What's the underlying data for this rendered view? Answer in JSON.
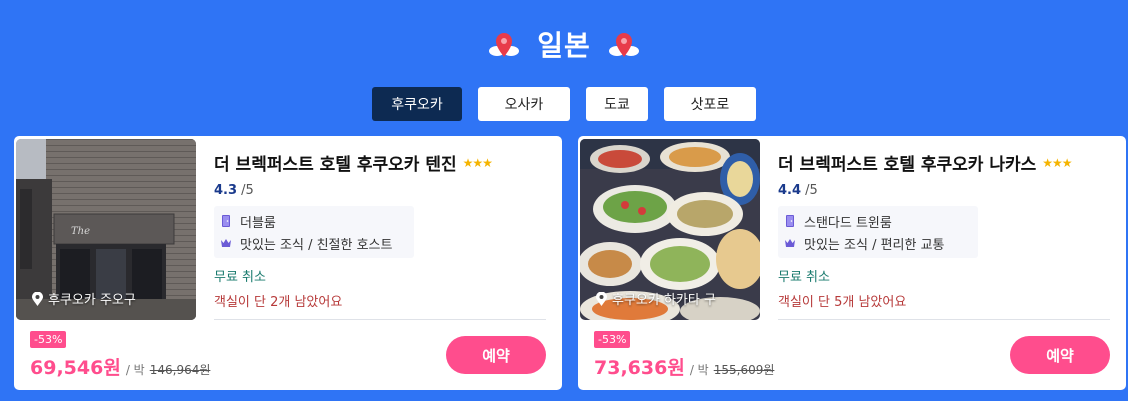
{
  "header": {
    "title": "일본",
    "colors": {
      "background": "#2f74f5",
      "pin": "#e83b4a",
      "cloud": "#ffffff"
    }
  },
  "tabs": [
    {
      "label": "후쿠오카",
      "active": true
    },
    {
      "label": "오사카",
      "active": false
    },
    {
      "label": "도쿄",
      "active": false
    },
    {
      "label": "삿포로",
      "active": false
    }
  ],
  "hotels": [
    {
      "name": "더 브렉퍼스트 호텔 후쿠오카 텐진",
      "stars": "★★★",
      "rating": "4.3",
      "rating_max": "/5",
      "room_type": "더블룸",
      "highlights": "맛있는 조식 / 친절한 호스트",
      "cancellation": "무료 취소",
      "availability": "객실이 단 2개 남았어요",
      "location": "후쿠오카 주오구",
      "discount": "-53%",
      "price": "69,546원",
      "per_night": "/ 박",
      "original_price": "146,964원",
      "book_label": "예약",
      "image": "hotel-building-photo"
    },
    {
      "name": "더 브렉퍼스트 호텔 후쿠오카 나카스",
      "stars": "★★★",
      "rating": "4.4",
      "rating_max": "/5",
      "room_type": "스탠다드 트윈룸",
      "highlights": "맛있는 조식 / 편리한 교통",
      "cancellation": "무료 취소",
      "availability": "객실이 단 5개 남았어요",
      "location": "후쿠오카 하카타 구",
      "discount": "-53%",
      "price": "73,636원",
      "per_night": "/ 박",
      "original_price": "155,609원",
      "book_label": "예약",
      "image": "breakfast-buffet-photo"
    }
  ],
  "colors": {
    "active_tab": "#0d2a52",
    "accent_pink": "#ff4d8d",
    "cancel_green": "#1a7b6e",
    "rooms_red": "#b73a3a",
    "rating_blue": "#1a3a8c",
    "star_gold": "#f5b400",
    "icon_purple": "#6b5bd6"
  }
}
